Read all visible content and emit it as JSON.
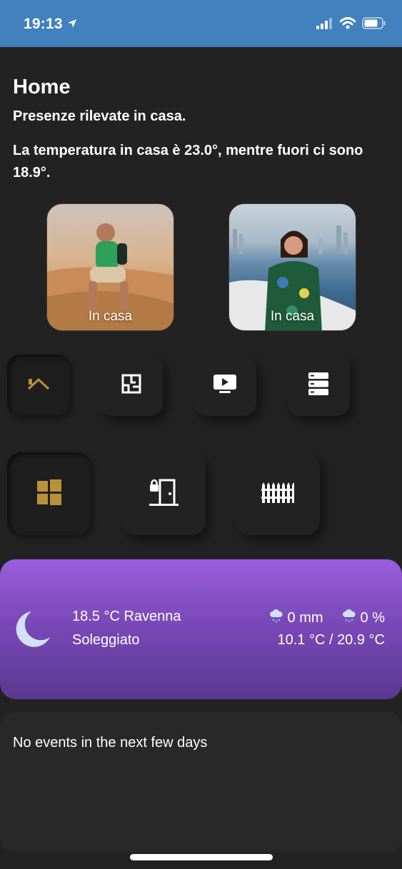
{
  "status_bar": {
    "time": "19:13",
    "icons": [
      "location-arrow-icon",
      "signal-icon",
      "wifi-icon",
      "battery-icon"
    ],
    "color": "#4281bd"
  },
  "header": {
    "title": "Home",
    "presence": "Presenze rilevate in casa.",
    "temperature_text": "La temperatura in casa è 23.0°, mentre fuori ci sono 18.9°."
  },
  "persons": [
    {
      "status": "In casa"
    },
    {
      "status": "In casa"
    }
  ],
  "nav": {
    "row1": [
      "home-roof-icon",
      "floorplan-icon",
      "tv-play-icon",
      "server-icon"
    ],
    "row2": [
      "window-icon",
      "door-lock-icon",
      "fence-icon"
    ],
    "accent": "#b9913a"
  },
  "weather": {
    "temp_location": "18.5 °C Ravenna",
    "condition": "Soleggiato",
    "precipitation": "0 mm",
    "precip_probability": "0 %",
    "range": "10.1 °C / 20.9 °C",
    "icon": "moon-icon"
  },
  "events": {
    "text": "No events in the next few days"
  }
}
